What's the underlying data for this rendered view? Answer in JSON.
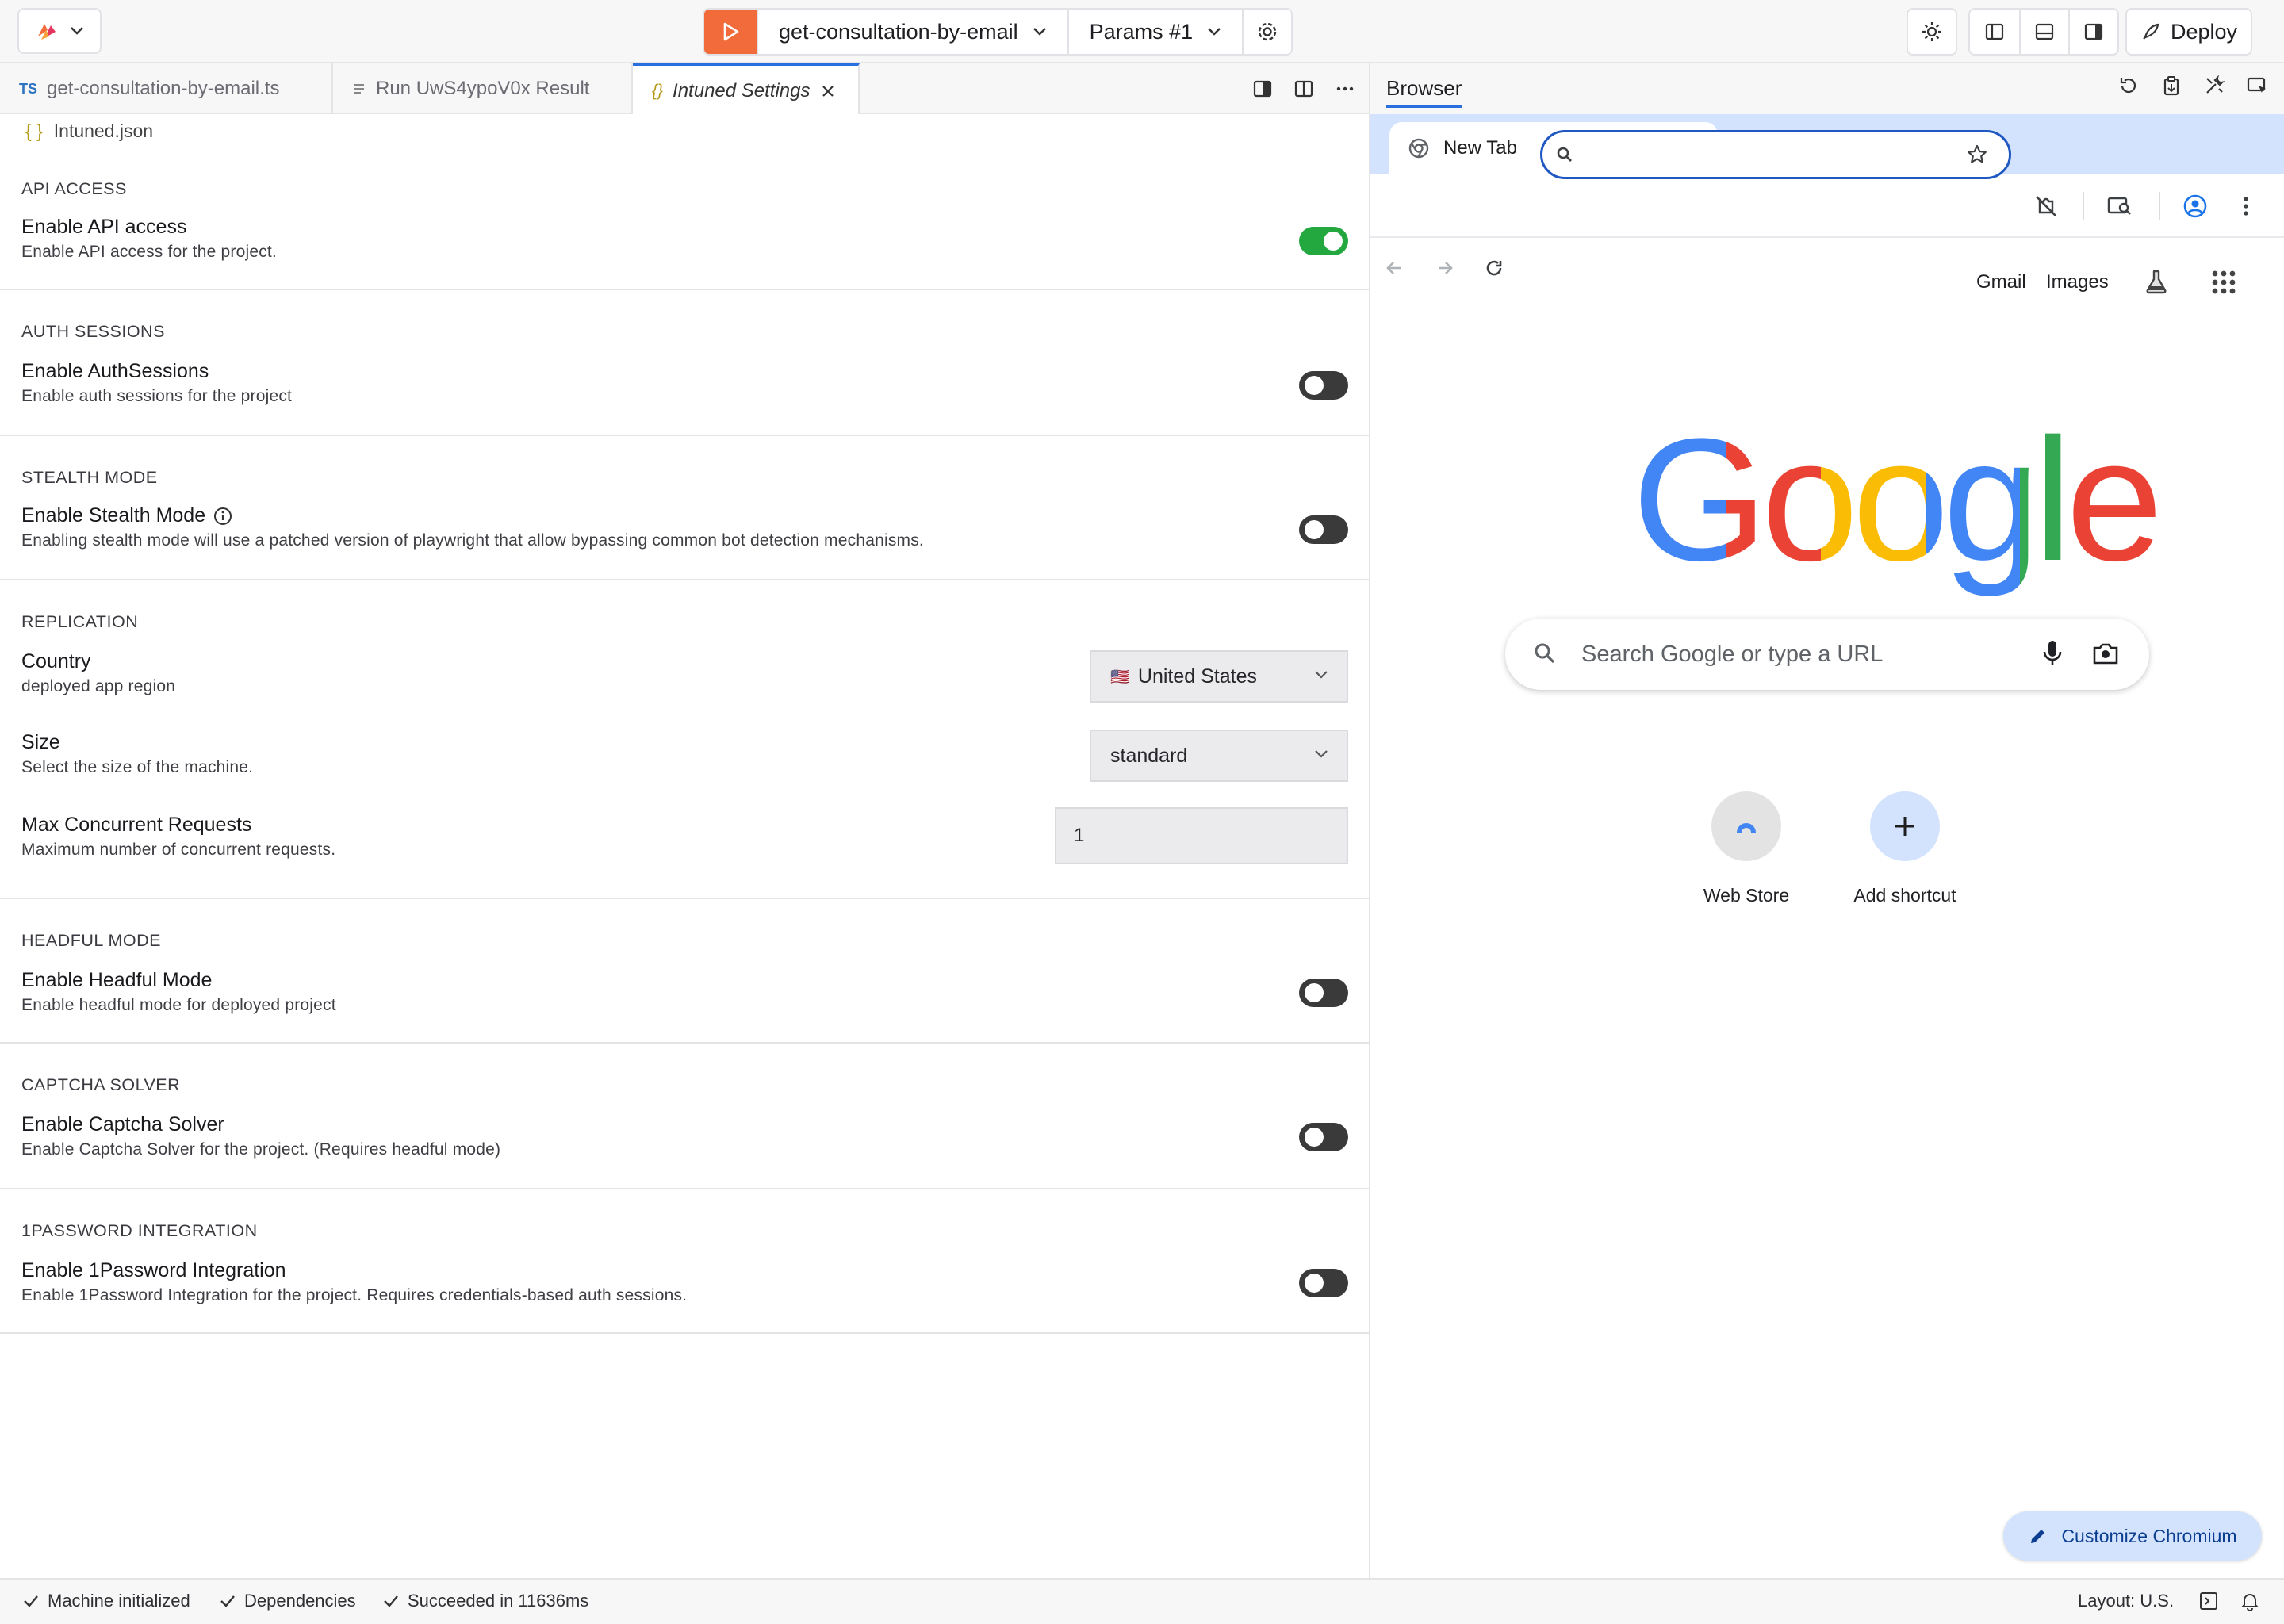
{
  "toolbar": {
    "run_target": "get-consultation-by-email",
    "params": "Params #1",
    "deploy_label": "Deploy"
  },
  "editor_tabs": [
    {
      "label": "get-consultation-by-email.ts",
      "icon": "TS"
    },
    {
      "label": "Run UwS4ypoV0x Result"
    },
    {
      "label": "Intuned Settings",
      "icon": "{}"
    }
  ],
  "settings": {
    "breadcrumb": "Intuned.json",
    "sections": [
      {
        "title": "API ACCESS",
        "row_title": "Enable API access",
        "row_desc": "Enable API access for the project.",
        "enabled": true
      },
      {
        "title": "AUTH SESSIONS",
        "row_title": "Enable AuthSessions",
        "row_desc": "Enable auth sessions for the project",
        "enabled": false
      },
      {
        "title": "STEALTH MODE",
        "row_title": "Enable Stealth Mode",
        "row_desc": "Enabling stealth mode will use a patched version of playwright that allow bypassing common bot detection mechanisms.",
        "enabled": false
      },
      {
        "title": "HEADFUL MODE",
        "row_title": "Enable Headful Mode",
        "row_desc": "Enable headful mode for deployed project",
        "enabled": false
      },
      {
        "title": "CAPTCHA SOLVER",
        "row_title": "Enable Captcha Solver",
        "row_desc": "Enable Captcha Solver for the project. (Requires headful mode)",
        "enabled": false
      },
      {
        "title": "1PASSWORD INTEGRATION",
        "row_title": "Enable 1Password Integration",
        "row_desc": "Enable 1Password Integration for the project. Requires credentials-based auth sessions.",
        "enabled": false
      }
    ],
    "replication": {
      "title": "REPLICATION",
      "country": {
        "label": "Country",
        "desc": "deployed app region",
        "value": "United States",
        "flag": "🇺🇸"
      },
      "size": {
        "label": "Size",
        "desc": "Select the size of the machine.",
        "value": "standard"
      },
      "max_concurrent": {
        "label": "Max Concurrent Requests",
        "desc": "Maximum number of concurrent requests.",
        "value": "1"
      }
    }
  },
  "browser": {
    "panel_title": "Browser",
    "tab_title": "New Tab",
    "links": {
      "gmail": "Gmail",
      "images": "Images"
    },
    "logo_text": "Google",
    "search_placeholder": "Search Google or type a URL",
    "shortcuts": [
      {
        "label": "Web Store"
      },
      {
        "label": "Add shortcut"
      }
    ],
    "customize_label": "Customize Chromium"
  },
  "statusbar": {
    "items": [
      "Machine initialized",
      "Dependencies",
      "Succeeded in 11636ms"
    ],
    "layout": "Layout: U.S."
  },
  "colors": {
    "accent_orange": "#f26b3a",
    "toggle_on": "#22a83f",
    "toggle_off": "#3a3a3a",
    "link_blue": "#2a6fe0"
  }
}
